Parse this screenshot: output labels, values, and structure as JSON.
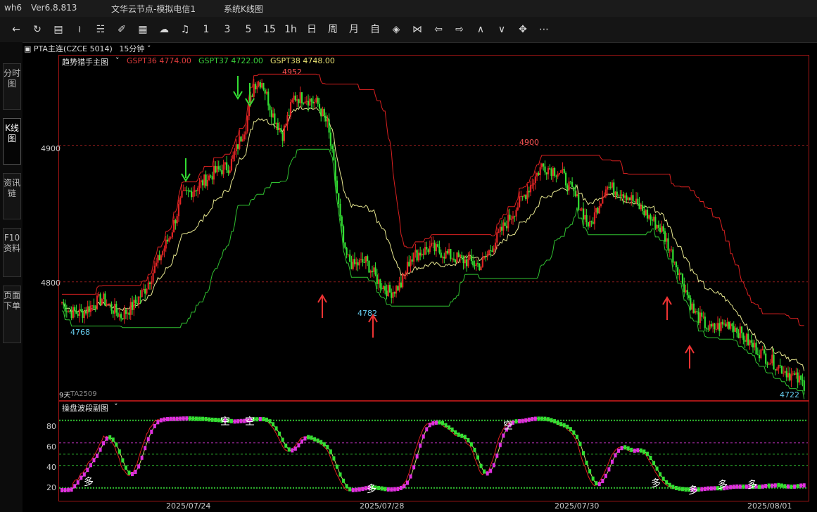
{
  "window": {
    "app": "wh6",
    "version": "Ver6.8.813",
    "server": "文华云节点-模拟电信1",
    "title": "系统K线图"
  },
  "toolbar": {
    "periods": [
      "1",
      "3",
      "5",
      "15",
      "1h",
      "日",
      "周",
      "月",
      "自"
    ]
  },
  "sidebar": {
    "tabs": [
      "分时图",
      "K线图",
      "资讯链",
      "F10资料",
      "页面下单"
    ]
  },
  "instrument": {
    "name": "PTA主连(CZCE 5014)",
    "period": "15分钟"
  },
  "main_indicator": {
    "name": "趋势猎手主图",
    "lines": [
      {
        "label": "GSPT36 4774.00",
        "color": "#e03c3c"
      },
      {
        "label": "GSPT37 4722.00",
        "color": "#3ad13a"
      },
      {
        "label": "GSPT38 4748.00",
        "color": "#e8e070"
      }
    ]
  },
  "sub_indicator": {
    "name": "操盘波段副图"
  },
  "bottom_left": {
    "days": "9天",
    "contract": "TA2509"
  },
  "colors": {
    "up": "#e02424",
    "down": "#33e033",
    "upper_band": "#d92020",
    "middle_band": "#e8e890",
    "lower_band": "#30c030",
    "frame": "#a31515",
    "magenta": "#e030e0"
  },
  "chart_data": [
    {
      "type": "candlestick",
      "title": "趋势猎手主图",
      "ylim": [
        4718,
        4960
      ],
      "y_ticks": [
        4800,
        4900
      ],
      "x_ticks": [
        "2025/07/24",
        "2025/07/28",
        "2025/07/30",
        "2025/08/01"
      ],
      "bar_count": 240,
      "anchors": [
        [
          0,
          4785
        ],
        [
          5,
          4778
        ],
        [
          12,
          4777
        ],
        [
          25,
          4788
        ],
        [
          32,
          4780
        ],
        [
          37,
          4775
        ],
        [
          45,
          4783
        ],
        [
          52,
          4795
        ],
        [
          58,
          4810
        ],
        [
          68,
          4835
        ],
        [
          75,
          4862
        ],
        [
          85,
          4870
        ],
        [
          95,
          4880
        ],
        [
          105,
          4885
        ],
        [
          115,
          4915
        ],
        [
          120,
          4945
        ],
        [
          125,
          4947
        ],
        [
          132,
          4922
        ],
        [
          138,
          4908
        ],
        [
          145,
          4935
        ],
        [
          152,
          4935
        ],
        [
          160,
          4930
        ],
        [
          166,
          4915
        ],
        [
          170,
          4885
        ],
        [
          174,
          4845
        ],
        [
          177,
          4820
        ],
        [
          182,
          4812
        ],
        [
          190,
          4815
        ],
        [
          198,
          4800
        ],
        [
          205,
          4792
        ],
        [
          212,
          4798
        ],
        [
          218,
          4818
        ]
      ],
      "annotations": {
        "high_label": "4952",
        "low_label_left": "4768",
        "low_label_mid": "4782",
        "high_label_2": "4900",
        "last_label": "4722",
        "sell_arrow_count": 3,
        "buy_arrow_count": 4
      },
      "series": [
        {
          "name": "GSPT36",
          "value": 4774.0
        },
        {
          "name": "GSPT37",
          "value": 4722.0
        },
        {
          "name": "GSPT38",
          "value": 4748.0
        }
      ]
    },
    {
      "type": "line",
      "title": "操盘波段副图",
      "ylim": [
        13,
        88
      ],
      "y_ticks": [
        20,
        40,
        60,
        80
      ],
      "signals": [
        "多",
        "空",
        "空",
        "多",
        "空",
        "多",
        "多",
        "多",
        "多"
      ]
    }
  ]
}
